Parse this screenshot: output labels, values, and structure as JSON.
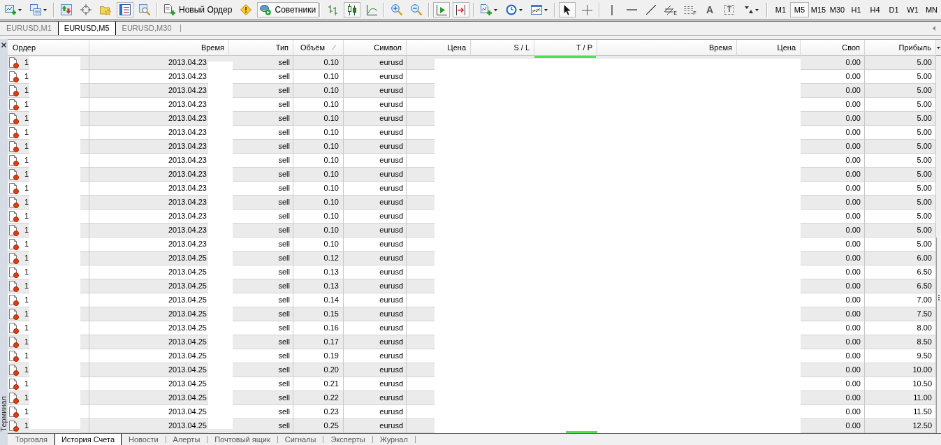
{
  "toolbar": [
    [
      {
        "kind": "dropdown",
        "pressed": false
      },
      {
        "kind": "dropdown",
        "pressed": false
      }
    ],
    [
      {
        "kind": "icon",
        "pressed": false
      },
      {
        "kind": "icon",
        "pressed": false
      },
      {
        "kind": "icon",
        "pressed": false
      },
      {
        "kind": "icon",
        "pressed": true
      },
      {
        "kind": "icon",
        "pressed": false
      }
    ],
    [
      {
        "kind": "labeled",
        "label": "Новый Ордер",
        "pressed": false
      },
      {
        "kind": "icon",
        "pressed": false
      },
      {
        "kind": "labeled",
        "label": "Советники",
        "pressed": true
      }
    ],
    [
      {
        "kind": "icon",
        "pressed": false
      },
      {
        "kind": "icon",
        "pressed": true
      },
      {
        "kind": "icon",
        "pressed": false
      }
    ],
    [
      {
        "kind": "icon",
        "pressed": false
      },
      {
        "kind": "icon",
        "pressed": false
      }
    ],
    [
      {
        "kind": "icon",
        "pressed": true
      },
      {
        "kind": "icon",
        "pressed": true
      }
    ],
    [
      {
        "kind": "dropdown",
        "pressed": false
      },
      {
        "kind": "dropdown",
        "pressed": false
      },
      {
        "kind": "dropdown",
        "pressed": false
      }
    ],
    [
      {
        "kind": "icon",
        "pressed": true
      },
      {
        "kind": "icon",
        "pressed": false
      }
    ],
    [
      {
        "kind": "icon",
        "pressed": false
      },
      {
        "kind": "icon",
        "pressed": false
      },
      {
        "kind": "icon",
        "pressed": false
      },
      {
        "kind": "icon",
        "pressed": false,
        "subscript": "E"
      },
      {
        "kind": "icon",
        "pressed": false,
        "subscript": "F"
      },
      {
        "kind": "glyph",
        "text": "A",
        "pressed": false
      },
      {
        "kind": "glyph",
        "text": "T",
        "framed": true,
        "pressed": false
      },
      {
        "kind": "dropdown",
        "pressed": false
      }
    ]
  ],
  "timeframes": [
    {
      "label": "M1",
      "selected": false
    },
    {
      "label": "M5",
      "selected": true
    },
    {
      "label": "M15",
      "selected": false
    },
    {
      "label": "M30",
      "selected": false
    },
    {
      "label": "H1",
      "selected": false
    },
    {
      "label": "H4",
      "selected": false
    },
    {
      "label": "D1",
      "selected": false
    },
    {
      "label": "W1",
      "selected": false
    },
    {
      "label": "MN",
      "selected": false
    }
  ],
  "chart_tabs": [
    {
      "label": "EURUSD,M1",
      "selected": false
    },
    {
      "label": "EURUSD,M5",
      "selected": true
    },
    {
      "label": "EURUSD,M30",
      "selected": false
    }
  ],
  "terminal": {
    "title": "Терминал",
    "columns": [
      {
        "label": "Ордер",
        "sorted": false
      },
      {
        "label": "Время",
        "sorted": false
      },
      {
        "label": "Тип",
        "sorted": false
      },
      {
        "label": "Объём",
        "sorted": true
      },
      {
        "label": "Символ",
        "sorted": false
      },
      {
        "label": "Цена",
        "sorted": false
      },
      {
        "label": "S / L",
        "sorted": false
      },
      {
        "label": "T / P",
        "sorted": false
      },
      {
        "label": "Время",
        "sorted": false
      },
      {
        "label": "Цена",
        "sorted": false
      },
      {
        "label": "Своп",
        "sorted": false
      },
      {
        "label": "Прибыль",
        "sorted": false
      }
    ],
    "rows": [
      {
        "order": "1",
        "time": "2013.04.23",
        "type": "sell",
        "volume": "0.10",
        "symbol": "eurusd",
        "swap": "0.00",
        "profit": "5.00"
      },
      {
        "order": "1",
        "time": "2013.04.23",
        "type": "sell",
        "volume": "0.10",
        "symbol": "eurusd",
        "swap": "0.00",
        "profit": "5.00"
      },
      {
        "order": "1",
        "time": "2013.04.23",
        "type": "sell",
        "volume": "0.10",
        "symbol": "eurusd",
        "swap": "0.00",
        "profit": "5.00"
      },
      {
        "order": "1",
        "time": "2013.04.23",
        "type": "sell",
        "volume": "0.10",
        "symbol": "eurusd",
        "swap": "0.00",
        "profit": "5.00"
      },
      {
        "order": "1",
        "time": "2013.04.23",
        "type": "sell",
        "volume": "0.10",
        "symbol": "eurusd",
        "swap": "0.00",
        "profit": "5.00"
      },
      {
        "order": "1",
        "time": "2013.04.23",
        "type": "sell",
        "volume": "0.10",
        "symbol": "eurusd",
        "swap": "0.00",
        "profit": "5.00"
      },
      {
        "order": "1",
        "time": "2013.04.23",
        "type": "sell",
        "volume": "0.10",
        "symbol": "eurusd",
        "swap": "0.00",
        "profit": "5.00"
      },
      {
        "order": "1",
        "time": "2013.04.23",
        "type": "sell",
        "volume": "0.10",
        "symbol": "eurusd",
        "swap": "0.00",
        "profit": "5.00"
      },
      {
        "order": "1",
        "time": "2013.04.23",
        "type": "sell",
        "volume": "0.10",
        "symbol": "eurusd",
        "swap": "0.00",
        "profit": "5.00"
      },
      {
        "order": "1",
        "time": "2013.04.23",
        "type": "sell",
        "volume": "0.10",
        "symbol": "eurusd",
        "swap": "0.00",
        "profit": "5.00"
      },
      {
        "order": "1",
        "time": "2013.04.23",
        "type": "sell",
        "volume": "0.10",
        "symbol": "eurusd",
        "swap": "0.00",
        "profit": "5.00"
      },
      {
        "order": "1",
        "time": "2013.04.23",
        "type": "sell",
        "volume": "0.10",
        "symbol": "eurusd",
        "swap": "0.00",
        "profit": "5.00"
      },
      {
        "order": "1",
        "time": "2013.04.23",
        "type": "sell",
        "volume": "0.10",
        "symbol": "eurusd",
        "swap": "0.00",
        "profit": "5.00"
      },
      {
        "order": "1",
        "time": "2013.04.23",
        "type": "sell",
        "volume": "0.10",
        "symbol": "eurusd",
        "swap": "0.00",
        "profit": "5.00"
      },
      {
        "order": "1",
        "time": "2013.04.25",
        "type": "sell",
        "volume": "0.12",
        "symbol": "eurusd",
        "swap": "0.00",
        "profit": "6.00"
      },
      {
        "order": "1",
        "time": "2013.04.25",
        "type": "sell",
        "volume": "0.13",
        "symbol": "eurusd",
        "swap": "0.00",
        "profit": "6.50"
      },
      {
        "order": "1",
        "time": "2013.04.25",
        "type": "sell",
        "volume": "0.13",
        "symbol": "eurusd",
        "swap": "0.00",
        "profit": "6.50"
      },
      {
        "order": "1",
        "time": "2013.04.25",
        "type": "sell",
        "volume": "0.14",
        "symbol": "eurusd",
        "swap": "0.00",
        "profit": "7.00"
      },
      {
        "order": "1",
        "time": "2013.04.25",
        "type": "sell",
        "volume": "0.15",
        "symbol": "eurusd",
        "swap": "0.00",
        "profit": "7.50"
      },
      {
        "order": "1",
        "time": "2013.04.25",
        "type": "sell",
        "volume": "0.16",
        "symbol": "eurusd",
        "swap": "0.00",
        "profit": "8.00"
      },
      {
        "order": "1",
        "time": "2013.04.25",
        "type": "sell",
        "volume": "0.17",
        "symbol": "eurusd",
        "swap": "0.00",
        "profit": "8.50"
      },
      {
        "order": "1",
        "time": "2013.04.25",
        "type": "sell",
        "volume": "0.19",
        "symbol": "eurusd",
        "swap": "0.00",
        "profit": "9.50"
      },
      {
        "order": "1",
        "time": "2013.04.25",
        "type": "sell",
        "volume": "0.20",
        "symbol": "eurusd",
        "swap": "0.00",
        "profit": "10.00"
      },
      {
        "order": "1",
        "time": "2013.04.25",
        "type": "sell",
        "volume": "0.21",
        "symbol": "eurusd",
        "swap": "0.00",
        "profit": "10.50"
      },
      {
        "order": "1",
        "time": "2013.04.25",
        "type": "sell",
        "volume": "0.22",
        "symbol": "eurusd",
        "swap": "0.00",
        "profit": "11.00"
      },
      {
        "order": "1",
        "time": "2013.04.25",
        "type": "sell",
        "volume": "0.23",
        "symbol": "eurusd",
        "swap": "0.00",
        "profit": "11.50"
      },
      {
        "order": "1",
        "time": "2013.04.25",
        "type": "sell",
        "volume": "0.25",
        "symbol": "eurusd",
        "swap": "0.00",
        "profit": "12.50"
      }
    ]
  },
  "tabs": [
    {
      "label": "Торговля",
      "selected": false
    },
    {
      "label": "История Счета",
      "selected": true
    },
    {
      "label": "Новости",
      "selected": false
    },
    {
      "label": "Алерты",
      "selected": false
    },
    {
      "label": "Почтовый ящик",
      "selected": false
    },
    {
      "label": "Сигналы",
      "selected": false
    },
    {
      "label": "Эксперты",
      "selected": false
    },
    {
      "label": "Журнал",
      "selected": false
    }
  ]
}
